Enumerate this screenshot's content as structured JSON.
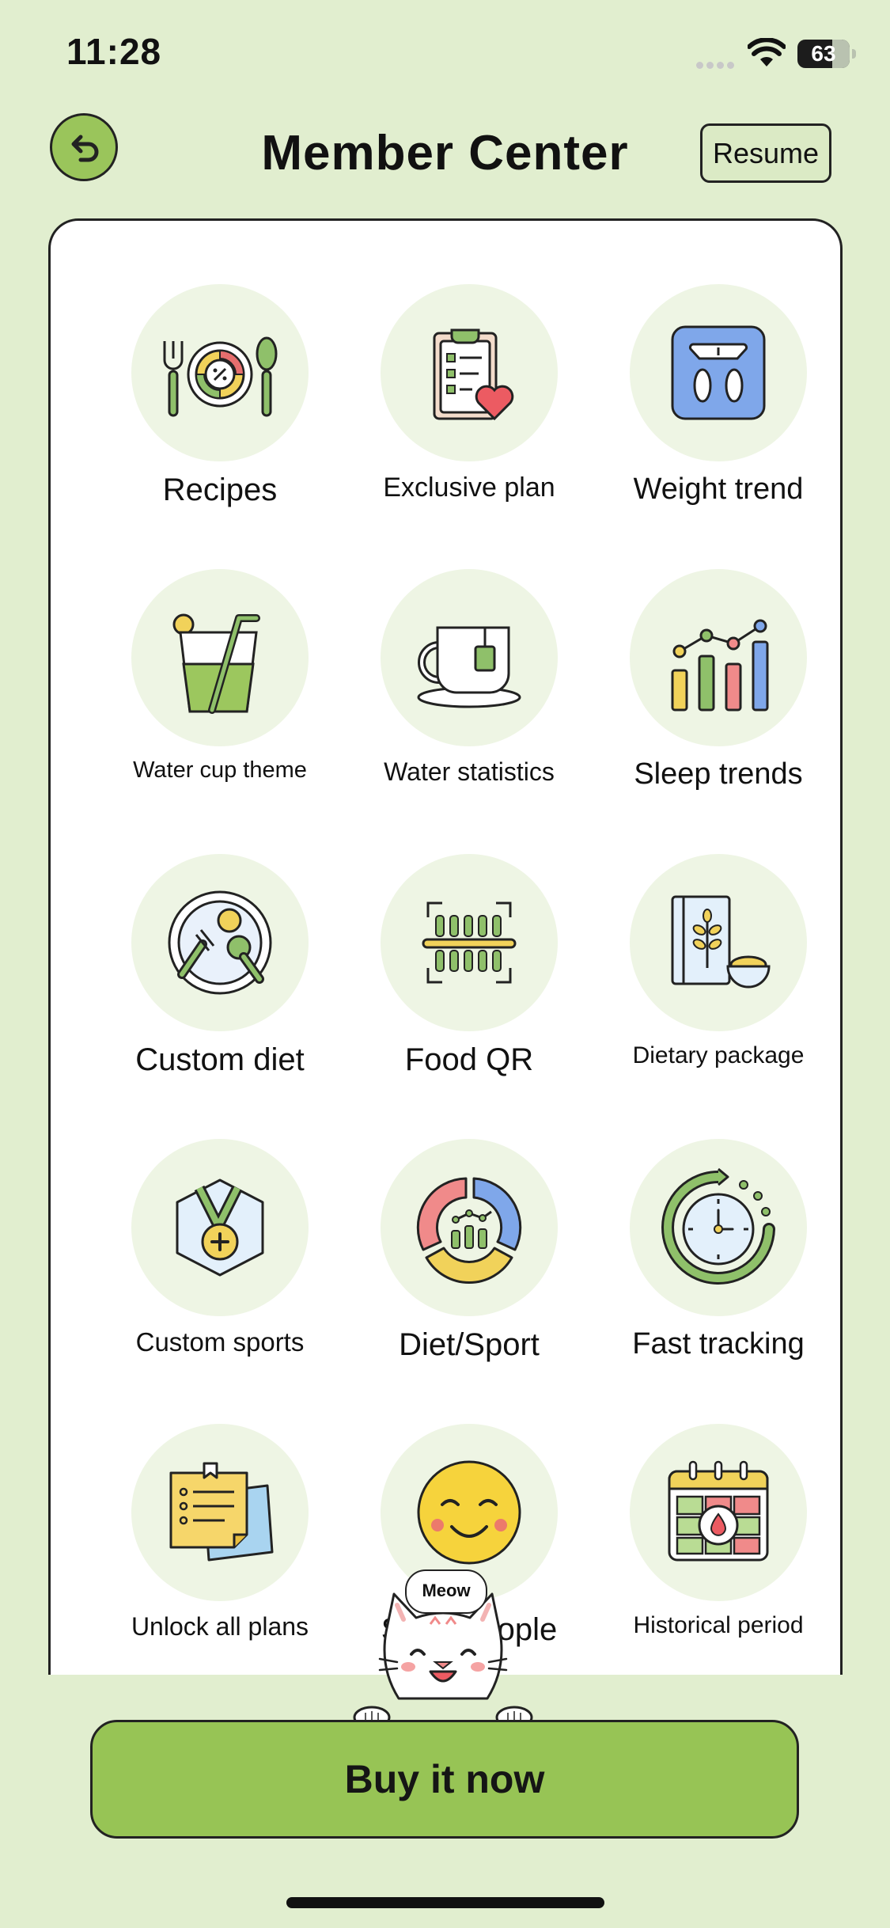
{
  "status_bar": {
    "time": "11:28",
    "battery": "63"
  },
  "header": {
    "title": "Member Center",
    "resume_label": "Resume",
    "back_icon": "back-arrow-icon"
  },
  "colors": {
    "background": "#e1eecf",
    "accent": "#97c455",
    "card": "#ffffff",
    "icon_circle": "#eef5e4"
  },
  "features": [
    {
      "label": "Recipes",
      "icon": "recipes-plate-icon"
    },
    {
      "label": "Exclusive plan",
      "icon": "clipboard-heart-icon"
    },
    {
      "label": "Weight trend",
      "icon": "weight-scale-icon"
    },
    {
      "label": "Water cup theme",
      "icon": "water-cup-icon"
    },
    {
      "label": "Water statistics",
      "icon": "tea-cup-icon"
    },
    {
      "label": "Sleep trends",
      "icon": "bar-chart-icon"
    },
    {
      "label": "Custom diet",
      "icon": "diet-plate-icon"
    },
    {
      "label": "Food QR",
      "icon": "barcode-scan-icon"
    },
    {
      "label": "Dietary package",
      "icon": "recipe-book-icon"
    },
    {
      "label": "Custom sports",
      "icon": "medal-icon"
    },
    {
      "label": "Diet/Sport",
      "icon": "donut-chart-icon"
    },
    {
      "label": "Fast tracking",
      "icon": "timer-icon"
    },
    {
      "label": "Unlock all plans",
      "icon": "notes-icon"
    },
    {
      "label": "Scan people",
      "icon": "smiley-face-icon"
    },
    {
      "label": "Historical period",
      "icon": "calendar-drop-icon"
    }
  ],
  "mascot": {
    "bubble_text": "Meow"
  },
  "buy_button": {
    "label": "Buy it now"
  }
}
